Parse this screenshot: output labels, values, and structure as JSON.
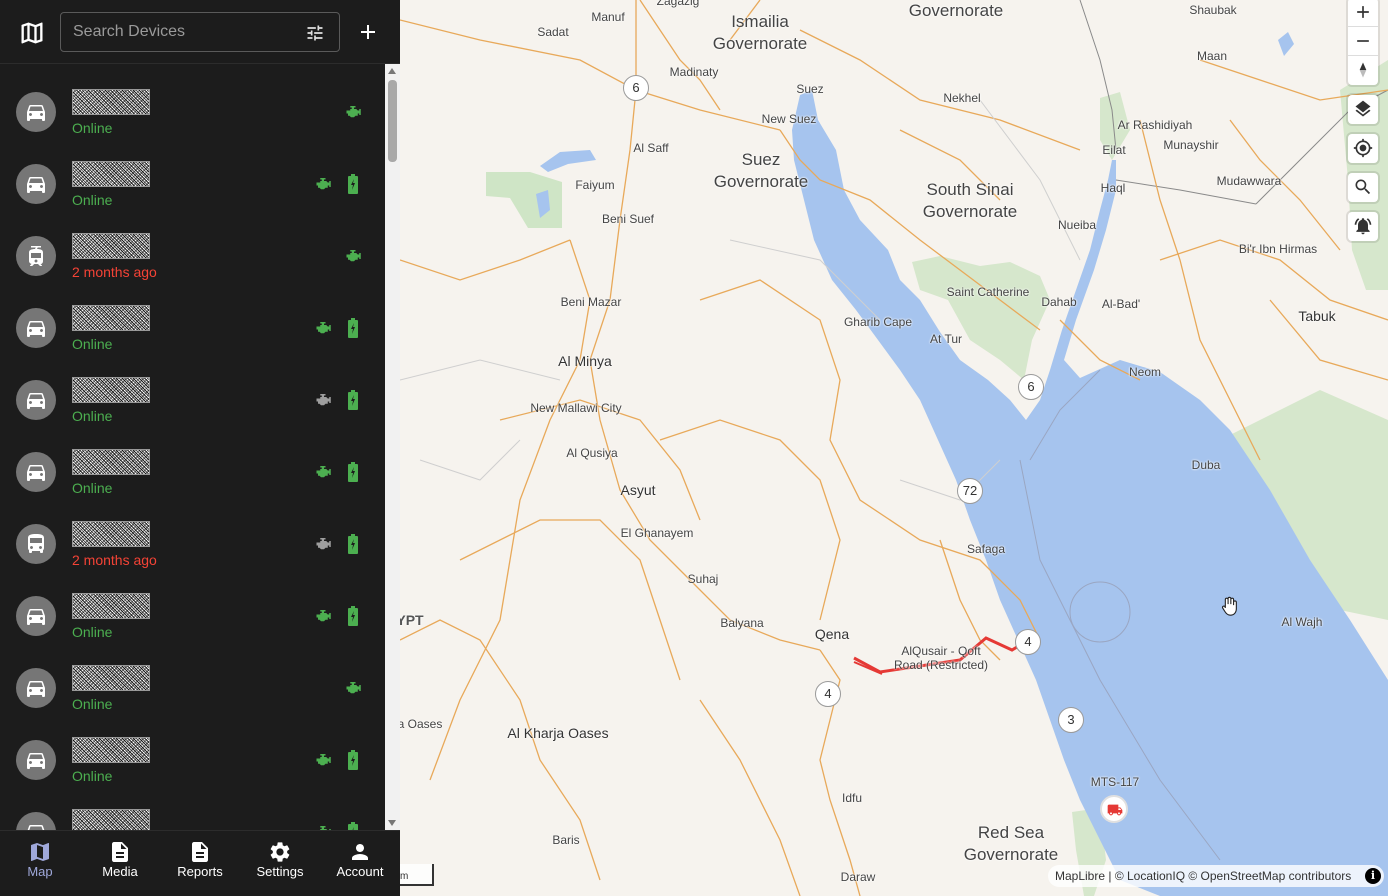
{
  "search": {
    "placeholder": "Search Devices"
  },
  "devices": [
    {
      "status": "Online",
      "state": "online",
      "icon": "car-icon",
      "engine": true,
      "battery": false
    },
    {
      "status": "Online",
      "state": "online",
      "icon": "car-icon",
      "engine": true,
      "battery": true
    },
    {
      "status": "2 months ago",
      "state": "offline",
      "icon": "tram-icon",
      "engine": true,
      "battery": false
    },
    {
      "status": "Online",
      "state": "online",
      "icon": "car-icon",
      "engine": true,
      "battery": true
    },
    {
      "status": "Online",
      "state": "online",
      "icon": "car-icon",
      "engine": false,
      "battery": true
    },
    {
      "status": "Online",
      "state": "online",
      "icon": "car-icon",
      "engine": true,
      "battery": true
    },
    {
      "status": "2 months ago",
      "state": "offline",
      "icon": "bus-icon",
      "engine": false,
      "battery": true
    },
    {
      "status": "Online",
      "state": "online",
      "icon": "car-icon",
      "engine": true,
      "battery": true
    },
    {
      "status": "Online",
      "state": "online",
      "icon": "car-icon",
      "engine": true,
      "battery": false
    },
    {
      "status": "Online",
      "state": "online",
      "icon": "car-icon",
      "engine": true,
      "battery": true
    },
    {
      "status": "",
      "state": "online",
      "icon": "car-icon",
      "engine": true,
      "battery": true
    }
  ],
  "nav": {
    "map": "Map",
    "media": "Media",
    "reports": "Reports",
    "settings": "Settings",
    "account": "Account"
  },
  "map_labels": {
    "manuf": "Manuf",
    "zagazig": "Zagazig",
    "ismailia": "Ismailia",
    "ismailia_gov1": "Ismailia",
    "ismailia_gov2": "Governorate",
    "governorate_top": "Governorate",
    "shaubak": "Shaubak",
    "sadat": "Sadat",
    "madinaty": "Madinaty",
    "suez": "Suez",
    "nekhel": "Nekhel",
    "maan": "Maan",
    "new_suez": "New Suez",
    "ar_rashidiyah": "Ar Rashidiyah",
    "eilat": "Eilat",
    "munayshir": "Munayshir",
    "al_saff": "Al Saff",
    "suez_gov1": "Suez",
    "suez_gov2": "Governorate",
    "south_sinai1": "South Sinai",
    "south_sinai2": "Governorate",
    "faiyum": "Faiyum",
    "haql": "Haql",
    "mudawwara": "Mudawwara",
    "beni_suef": "Beni Suef",
    "nueiba": "Nueiba",
    "bir_ibn_hirmas": "Bi'r Ibn Hirmas",
    "saint_catherine": "Saint Catherine",
    "beni_mazar": "Beni Mazar",
    "dahab": "Dahab",
    "al_bad": "Al-Bad'",
    "tabuk": "Tabuk",
    "gharib_cape": "Gharib Cape",
    "at_tur": "At Tur",
    "al_minya": "Al Minya",
    "neom": "Neom",
    "new_mallawi": "New Mallawi City",
    "al_qusiya": "Al Qusiya",
    "duba": "Duba",
    "asyut": "Asyut",
    "safaga": "Safaga",
    "el_ghanayem": "El Ghanayem",
    "suhaj": "Suhaj",
    "egypt_partial": "YPT",
    "balyana": "Balyana",
    "qena": "Qena",
    "alqusair_road1": "AlQusair - Qoft",
    "alqusair_road2": "Road (Restricted)",
    "al_wajh": "Al Wajh",
    "oases_partial": "a Oases",
    "al_kharja": "Al Kharja Oases",
    "mts117": "MTS-117",
    "idfu": "Idfu",
    "red_sea1": "Red Sea",
    "red_sea2": "Governorate",
    "baris": "Baris",
    "daraw": "Daraw"
  },
  "route_shields": {
    "r6_west": "6",
    "r6_east": "6",
    "r72": "72",
    "r4_east": "4",
    "r4_west": "4",
    "r3": "3"
  },
  "map_footer": {
    "attribution": "MapLibre | © LocationIQ © OpenStreetMap contributors",
    "info": "i",
    "scale": "m"
  },
  "colors": {
    "sidebar_bg": "#1c1c1c",
    "online": "#4caf50",
    "offline": "#f44336",
    "active_nav": "#9fa8da",
    "sea": "#a6c4ee",
    "park": "#cfe5c6",
    "road": "#e8a95a",
    "route": "#e53935"
  }
}
